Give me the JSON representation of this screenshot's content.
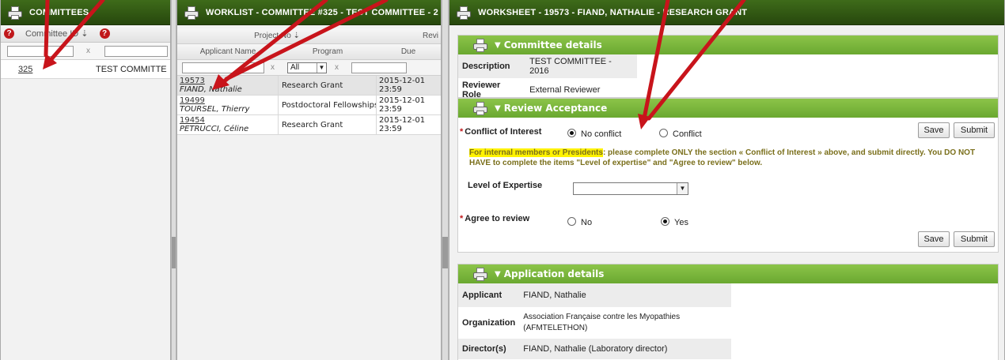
{
  "committees": {
    "title": "COMMITTEES",
    "col_committee_id": "Committee ID ⇣",
    "rows": [
      {
        "id": "325",
        "name": "TEST COMMITTE"
      }
    ]
  },
  "worklist": {
    "title": "WORKLIST - COMMITTEE #325 - TEST COMMITTEE - 2",
    "col_project": "Project No ⇣",
    "col_review": "Revi",
    "col_applicant": "Applicant Name",
    "col_program": "Program",
    "col_due": "Due",
    "program_filter": "All",
    "rows": [
      {
        "project": "19573",
        "applicant": "FIAND, Nathalie",
        "program": "Research Grant",
        "due_date": "2015-12-01",
        "due_time": "23:59"
      },
      {
        "project": "19499",
        "applicant": "TOURSEL, Thierry",
        "program": "Postdoctoral Fellowships",
        "due_date": "2015-12-01",
        "due_time": "23:59"
      },
      {
        "project": "19454",
        "applicant": "PETRUCCI, Céline",
        "program": "Research Grant",
        "due_date": "2015-12-01",
        "due_time": "23:59"
      }
    ]
  },
  "worksheet": {
    "title": "WORKSHEET - 19573 - FIAND, NATHALIE - RESEARCH GRANT",
    "committee_details": {
      "heading": "Committee details",
      "description_label": "Description",
      "description_value": "TEST COMMITTEE - 2016",
      "role_label": "Reviewer Role",
      "role_value": "External Reviewer"
    },
    "review_acceptance": {
      "heading": "Review Acceptance",
      "conflict_label": "Conflict of Interest",
      "no_conflict": "No conflict",
      "conflict": "Conflict",
      "save": "Save",
      "submit": "Submit",
      "notice_highlight": "For internal members or Presidents",
      "notice_rest": ": please complete ONLY the section « Conflict of Interest » above, and submit directly. You DO NOT HAVE to complete the items \"Level of expertise\" and \"Agree to review\" below.",
      "expertise_label": "Level of Expertise",
      "agree_label": "Agree to review",
      "no": "No",
      "yes": "Yes"
    },
    "application_details": {
      "heading": "Application details",
      "applicant_label": "Applicant",
      "applicant_value": "FIAND, Nathalie",
      "organization_label": "Organization",
      "organization_line1": "Association Française contre les Myopathies",
      "organization_line2": "(AFMTELETHON)",
      "directors_label": "Director(s)",
      "directors_value": "FIAND, Nathalie (Laboratory director)"
    }
  },
  "colors": {
    "panel_header": "#2f5312",
    "section_header": "#7ab63c",
    "annotation_arrow": "#c8141b",
    "required_star": "#c0181b"
  }
}
